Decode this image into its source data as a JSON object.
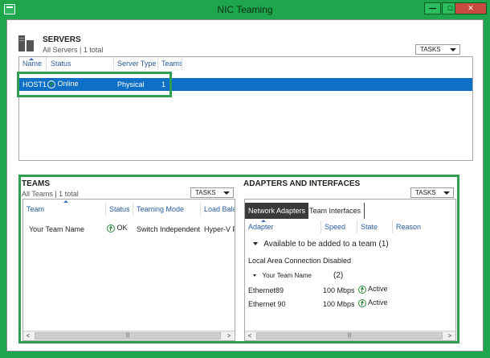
{
  "window": {
    "title": "NIC Teaming",
    "minimize": "—",
    "maximize": "□",
    "close": "✕"
  },
  "servers": {
    "title": "SERVERS",
    "subtitle": "All Servers | 1 total",
    "tasks_label": "TASKS",
    "columns": [
      "Name",
      "Status",
      "Server Type",
      "Teams"
    ],
    "rows": [
      {
        "name": "HOST1",
        "status": "Online",
        "server_type": "Physical",
        "teams": "1"
      }
    ]
  },
  "teams": {
    "title": "TEAMS",
    "subtitle": "All Teams | 1 total",
    "tasks_label": "TASKS",
    "columns": [
      "Team",
      "Status",
      "Teaming Mode",
      "Load Bala"
    ],
    "rows": [
      {
        "team": "Your Team Name",
        "status": "OK",
        "teaming_mode": "Switch Independent",
        "load_balancing": "Hyper-V P"
      }
    ]
  },
  "adapters": {
    "title": "ADAPTERS AND INTERFACES",
    "tasks_label": "TASKS",
    "tabs": [
      "Network Adapters",
      "Team Interfaces"
    ],
    "columns": [
      "Adapter",
      "Speed",
      "State",
      "Reason"
    ],
    "group_available": "Available to be added to a team (1)",
    "available_rows": [
      {
        "adapter": "Local Area Connection",
        "speed": "Disabled"
      }
    ],
    "team_group": {
      "name": "Your Team Name",
      "count": "(2)"
    },
    "team_rows": [
      {
        "adapter": "Ethernet89",
        "speed": "100 Mbps",
        "state": "Active"
      },
      {
        "adapter": "Ethernet 90",
        "speed": "100 Mbps",
        "state": "Active"
      }
    ]
  },
  "scrollbar": {
    "left": "<",
    "right": ">",
    "thumb": "|||"
  },
  "colors": {
    "accent": "#1ea64c",
    "selection": "#0d6fc5",
    "highlight_box": "#2e9e52"
  }
}
